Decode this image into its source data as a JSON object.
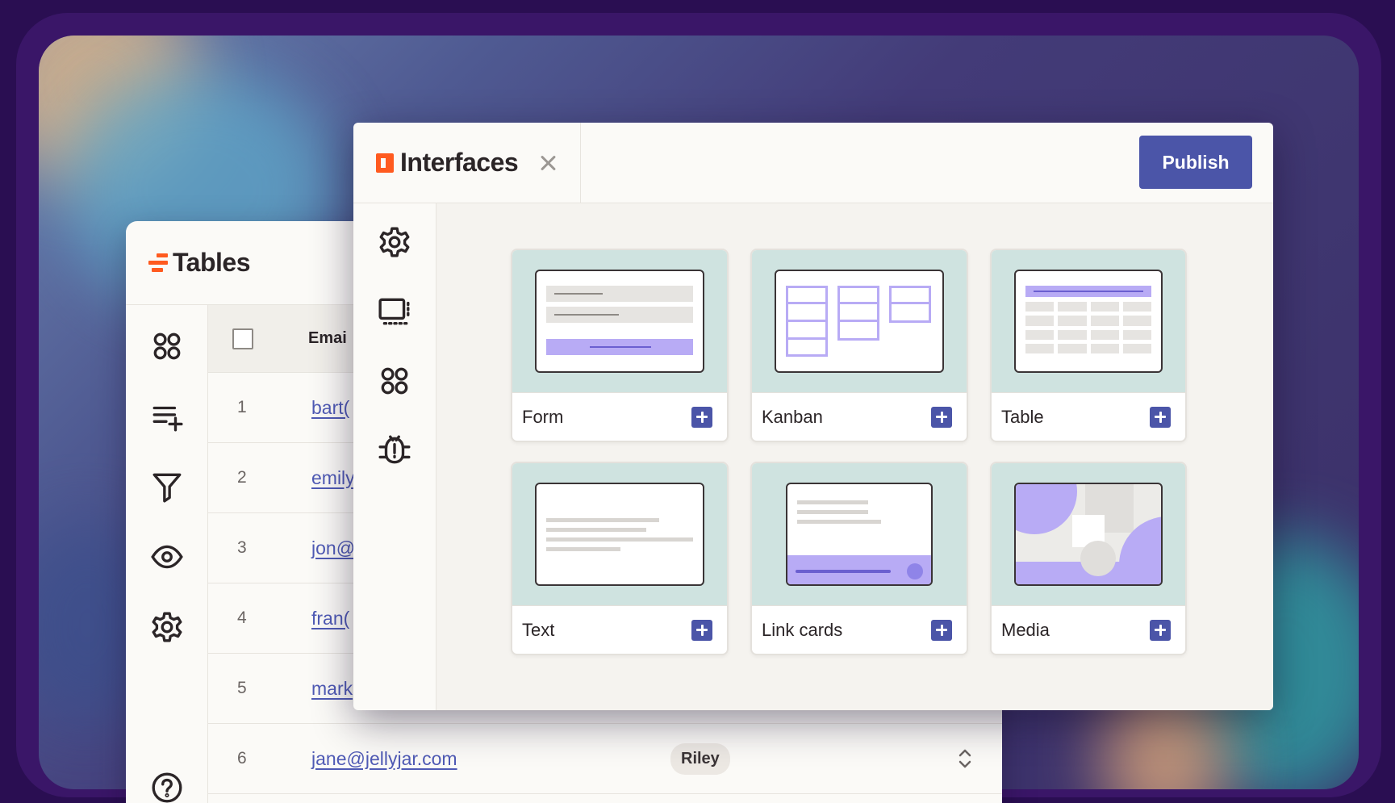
{
  "tables": {
    "title": "Tables",
    "column_header": "Emai",
    "rows": [
      {
        "num": "1",
        "email": "bart("
      },
      {
        "num": "2",
        "email": "emily"
      },
      {
        "num": "3",
        "email": "jon@"
      },
      {
        "num": "4",
        "email": "fran("
      },
      {
        "num": "5",
        "email": "mark"
      },
      {
        "num": "6",
        "email": "jane@jellyjar.com",
        "badge": "Riley"
      }
    ],
    "rail_icons": [
      "apps-icon",
      "add-field-icon",
      "filter-icon",
      "eye-icon",
      "gear-icon",
      "help-icon"
    ]
  },
  "interfaces": {
    "title": "Interfaces",
    "publish_label": "Publish",
    "rail_icons": [
      "gear-icon",
      "layout-icon",
      "apps-icon",
      "bug-icon"
    ],
    "components": [
      {
        "label": "Form"
      },
      {
        "label": "Kanban"
      },
      {
        "label": "Table"
      },
      {
        "label": "Text"
      },
      {
        "label": "Link cards"
      },
      {
        "label": "Media"
      }
    ]
  },
  "colors": {
    "accent": "#4b55a8",
    "brand_orange": "#ff5a1f",
    "preview_bg": "#cfe3e0",
    "lavender": "#b8abf5",
    "link": "#4f5ab5"
  }
}
